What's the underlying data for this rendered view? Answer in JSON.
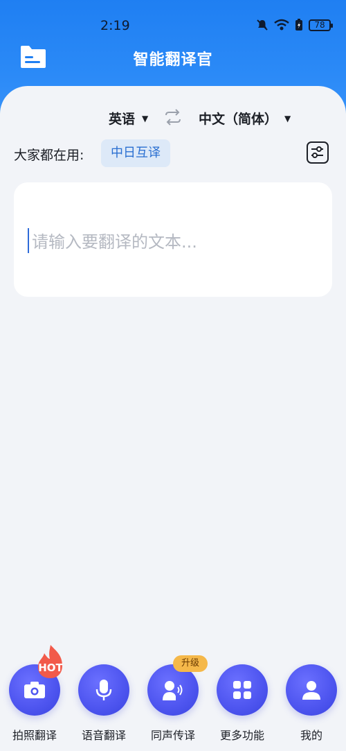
{
  "status_bar": {
    "time": "2:19",
    "battery": "78"
  },
  "header": {
    "title": "智能翻译官"
  },
  "language_bar": {
    "source": "英语",
    "target": "中文（简体）"
  },
  "common": {
    "label": "大家都在用:",
    "chip": "中日互译"
  },
  "input": {
    "placeholder": "请输入要翻译的文本..."
  },
  "nav": {
    "items": [
      {
        "label": "拍照翻译",
        "icon": "camera-icon",
        "badge": "HOT"
      },
      {
        "label": "语音翻译",
        "icon": "microphone-icon"
      },
      {
        "label": "同声传译",
        "icon": "speaker-person-icon",
        "badge": "升级"
      },
      {
        "label": "更多功能",
        "icon": "grid-icon"
      },
      {
        "label": "我的",
        "icon": "user-icon"
      }
    ]
  },
  "colors": {
    "header_blue": "#1f7ff2",
    "nav_purple": "#4f56f0",
    "hot_red": "#f25a4a",
    "upgrade_gold": "#f5b84a",
    "chip_blue": "#2a6fd1"
  }
}
